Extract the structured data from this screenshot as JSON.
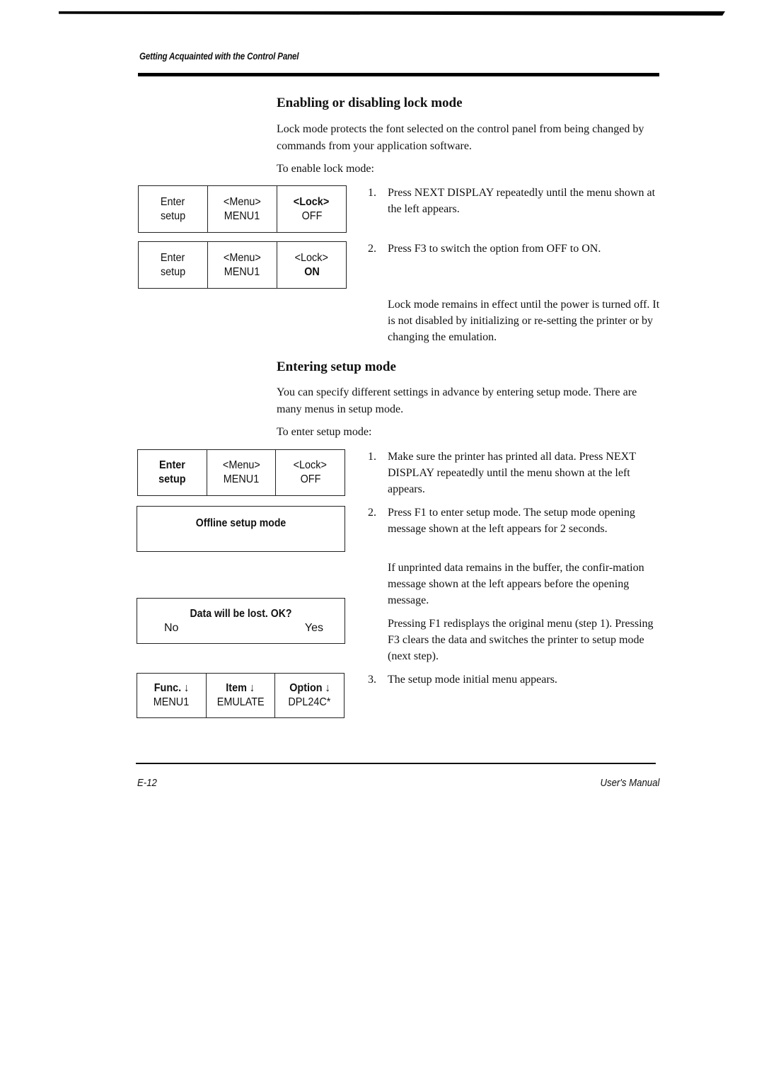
{
  "header": {
    "running_title": "Getting Acquainted with the Control Panel"
  },
  "lock_section": {
    "title": "Enabling or disabling lock mode",
    "intro": "Lock mode protects the font selected on the control panel from being changed by commands from your application software.",
    "lead": "To enable lock mode:",
    "panels": [
      {
        "cells": [
          {
            "line1": "Enter",
            "line2": "setup"
          },
          {
            "line1": "<Menu>",
            "line2": "MENU1"
          },
          {
            "line1": "<Lock>",
            "line2": "OFF"
          }
        ]
      },
      {
        "cells": [
          {
            "line1": "Enter",
            "line2": "setup"
          },
          {
            "line1": "<Menu>",
            "line2": "MENU1"
          },
          {
            "line1": "<Lock>",
            "line2": "ON"
          }
        ]
      }
    ],
    "steps": [
      {
        "num": "1.",
        "text": "Press NEXT DISPLAY repeatedly until the menu shown at the left appears."
      },
      {
        "num": "2.",
        "text": "Press F3 to switch the option from OFF to ON."
      }
    ],
    "note": "Lock mode remains in effect until the power is turned off. It is not disabled by initializing or re-setting the printer or by changing the emulation."
  },
  "setup_section": {
    "title": "Entering setup mode",
    "intro": "You can specify different settings in advance by entering setup mode. There are many menus in setup mode.",
    "lead": "To enter setup mode:",
    "panels": {
      "initial": {
        "cells": [
          {
            "line1": "Enter",
            "line2": "setup"
          },
          {
            "line1": "<Menu>",
            "line2": "MENU1"
          },
          {
            "line1": "<Lock>",
            "line2": "OFF"
          }
        ]
      },
      "offline": {
        "message": "Offline setup mode"
      },
      "confirm": {
        "message": "Data will be lost. OK?",
        "left": "No",
        "right": "Yes"
      },
      "setup_menu": {
        "cells": [
          {
            "line1": "Func. ↓",
            "line2": "MENU1"
          },
          {
            "line1": "Item ↓",
            "line2": "EMULATE"
          },
          {
            "line1": "Option ↓",
            "line2": "DPL24C*"
          }
        ]
      }
    },
    "steps": [
      {
        "num": "1.",
        "text": "Make sure the printer has printed all data. Press NEXT DISPLAY repeatedly until the menu shown at the left appears."
      },
      {
        "num": "2.",
        "text": "Press F1 to enter setup mode. The setup mode opening message shown at the left appears for 2 seconds."
      },
      {
        "num": "3.",
        "text": "The setup mode initial menu appears."
      }
    ],
    "notes": [
      "If unprinted data remains in the buffer, the confir-mation message shown at the left appears before the opening message.",
      "Pressing F1 redisplays the original menu (step 1). Pressing F3 clears the data and switches the printer to setup mode (next step)."
    ]
  },
  "footer": {
    "page_number": "E-12",
    "manual_title": "User's Manual"
  }
}
